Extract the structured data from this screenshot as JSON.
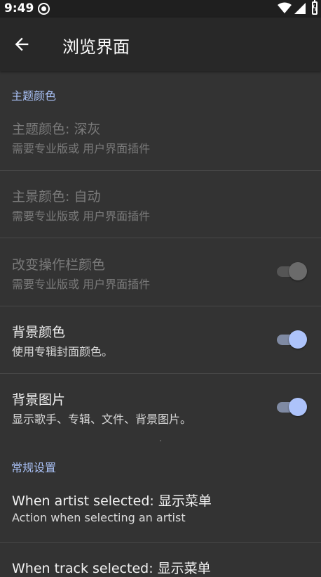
{
  "status_bar": {
    "time": "9:49"
  },
  "app_bar": {
    "title": "浏览界面"
  },
  "sections": {
    "theme_header": "主题颜色",
    "general_header": "常规设置"
  },
  "settings": [
    {
      "title": "主题颜色: 深灰",
      "subtitle": "需要专业版或 用户界面插件"
    },
    {
      "title": "主景颜色: 自动",
      "subtitle": "需要专业版或 用户界面插件"
    },
    {
      "title": "改变操作栏颜色",
      "subtitle": "需要专业版或 用户界面插件",
      "switch": "off"
    },
    {
      "title": "背景颜色",
      "subtitle": "使用专辑封面颜色。",
      "switch": "on"
    },
    {
      "title": "背景图片",
      "subtitle": "显示歌手、专辑、文件、背景图片。",
      "switch": "on"
    }
  ],
  "general": [
    {
      "title": "When artist selected: 显示菜单",
      "subtitle": "Action when selecting an artist"
    },
    {
      "title": "When track selected: 显示菜单"
    }
  ],
  "colors": {
    "accent": "#adc3fa",
    "background": "#333333",
    "app_bar": "#282828"
  },
  "icons": [
    "wifi-icon",
    "signal-icon",
    "battery-icon",
    "back-arrow-icon"
  ]
}
